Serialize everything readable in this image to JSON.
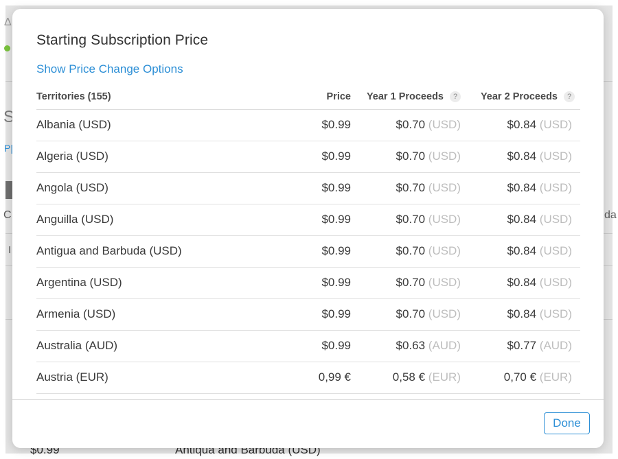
{
  "background": {
    "frag_delta": "Δ",
    "frag_s": "S",
    "frag_p": "P|",
    "frag_c": "Cı",
    "frag_i": "I",
    "frag_da": "da",
    "row_price": "$0.99",
    "row_territory": "Antiqua and Barbuda (USD)"
  },
  "modal": {
    "title": "Starting Subscription Price",
    "price_change_link": "Show Price Change Options",
    "columns": {
      "territories": "Territories (155)",
      "price": "Price",
      "year1": "Year 1 Proceeds",
      "year2": "Year 2 Proceeds",
      "help": "?"
    },
    "rows": [
      {
        "territory": "Albania (USD)",
        "price": "$0.99",
        "y1_value": "$0.70",
        "y1_cur": "(USD)",
        "y2_value": "$0.84",
        "y2_cur": "(USD)"
      },
      {
        "territory": "Algeria (USD)",
        "price": "$0.99",
        "y1_value": "$0.70",
        "y1_cur": "(USD)",
        "y2_value": "$0.84",
        "y2_cur": "(USD)"
      },
      {
        "territory": "Angola (USD)",
        "price": "$0.99",
        "y1_value": "$0.70",
        "y1_cur": "(USD)",
        "y2_value": "$0.84",
        "y2_cur": "(USD)"
      },
      {
        "territory": "Anguilla (USD)",
        "price": "$0.99",
        "y1_value": "$0.70",
        "y1_cur": "(USD)",
        "y2_value": "$0.84",
        "y2_cur": "(USD)"
      },
      {
        "territory": "Antigua and Barbuda (USD)",
        "price": "$0.99",
        "y1_value": "$0.70",
        "y1_cur": "(USD)",
        "y2_value": "$0.84",
        "y2_cur": "(USD)"
      },
      {
        "territory": "Argentina (USD)",
        "price": "$0.99",
        "y1_value": "$0.70",
        "y1_cur": "(USD)",
        "y2_value": "$0.84",
        "y2_cur": "(USD)"
      },
      {
        "territory": "Armenia (USD)",
        "price": "$0.99",
        "y1_value": "$0.70",
        "y1_cur": "(USD)",
        "y2_value": "$0.84",
        "y2_cur": "(USD)"
      },
      {
        "territory": "Australia (AUD)",
        "price": "$0.99",
        "y1_value": "$0.63",
        "y1_cur": "(AUD)",
        "y2_value": "$0.77",
        "y2_cur": "(AUD)"
      },
      {
        "territory": "Austria (EUR)",
        "price": "0,99 €",
        "y1_value": "0,58 €",
        "y1_cur": "(EUR)",
        "y2_value": "0,70 €",
        "y2_cur": "(EUR)"
      }
    ],
    "done_label": "Done"
  },
  "colors": {
    "accent": "#2d8fd6",
    "status_green": "#79c23c",
    "currency_gray": "#bdbdbd"
  }
}
